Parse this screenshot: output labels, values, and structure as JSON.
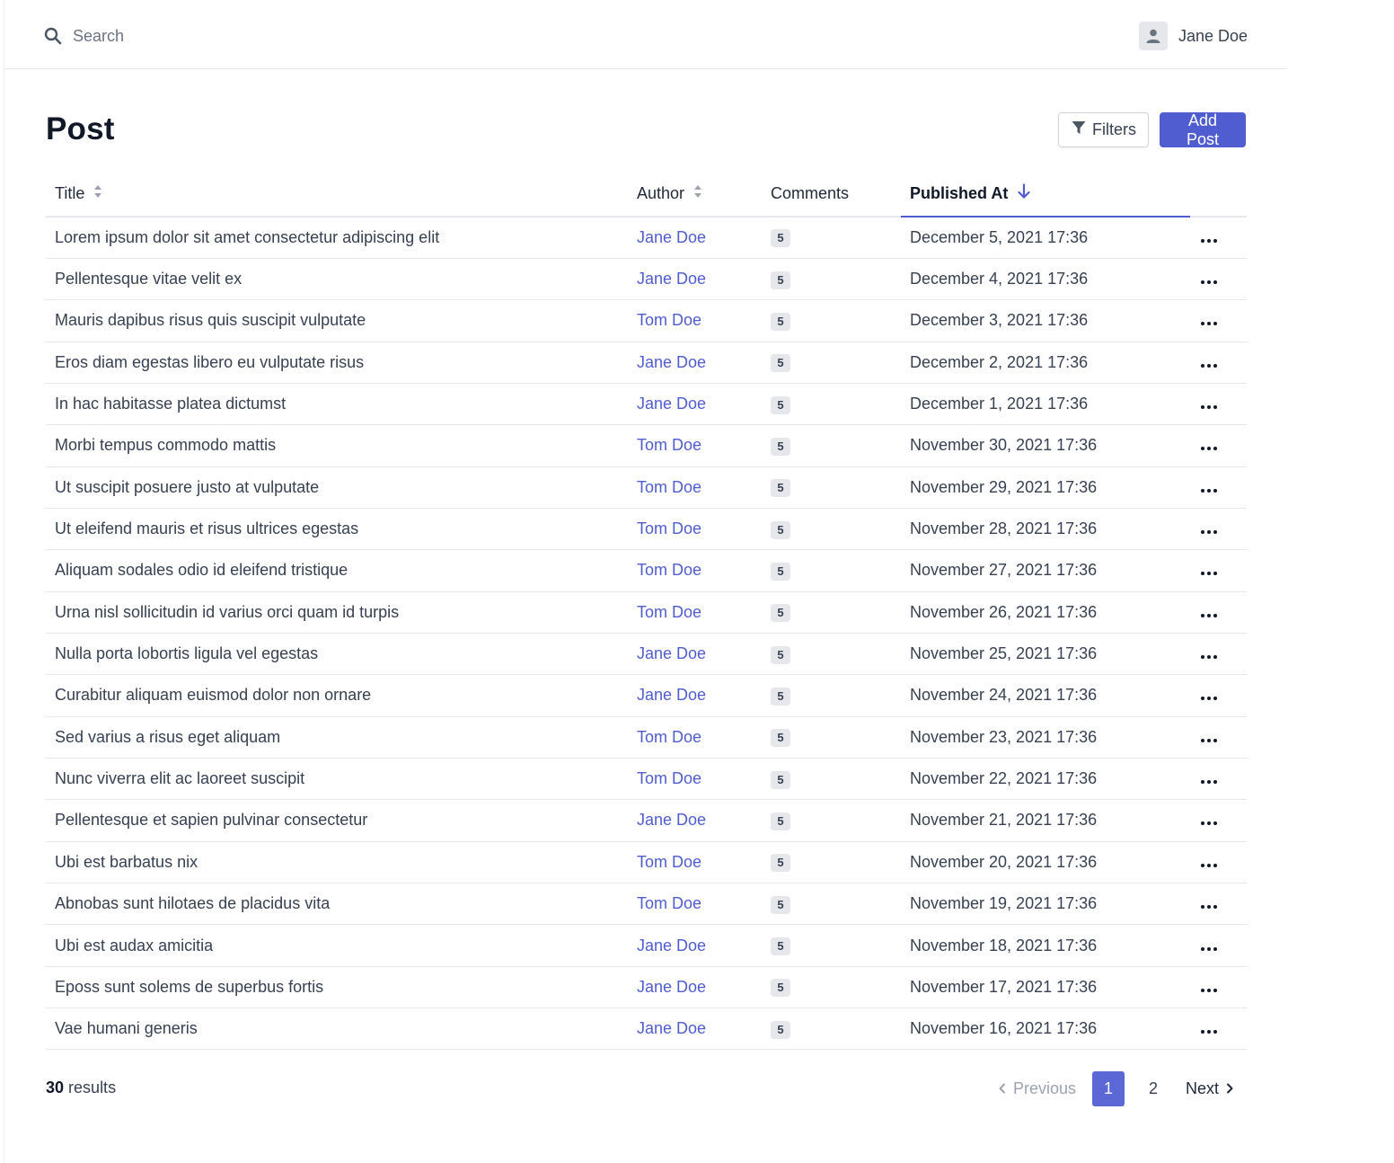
{
  "topbar": {
    "search_placeholder": "Search",
    "user_name": "Jane Doe",
    "search_icon": "search-icon",
    "user_icon": "user-icon"
  },
  "page": {
    "title": "Post",
    "filters_label": "Filters",
    "add_label": "Add Post"
  },
  "colors": {
    "accent": "#4f5dd0",
    "badge_bg": "#e5e7eb"
  },
  "table": {
    "columns": {
      "title": "Title",
      "author": "Author",
      "comments": "Comments",
      "published": "Published At"
    },
    "sort_column": "Published At",
    "sort_direction": "descending",
    "rows": [
      {
        "title": "Lorem ipsum dolor sit amet consectetur adipiscing elit",
        "author": "Jane Doe",
        "comments": "5",
        "published": "December 5, 2021 17:36"
      },
      {
        "title": "Pellentesque vitae velit ex",
        "author": "Jane Doe",
        "comments": "5",
        "published": "December 4, 2021 17:36"
      },
      {
        "title": "Mauris dapibus risus quis suscipit vulputate",
        "author": "Tom Doe",
        "comments": "5",
        "published": "December 3, 2021 17:36"
      },
      {
        "title": "Eros diam egestas libero eu vulputate risus",
        "author": "Jane Doe",
        "comments": "5",
        "published": "December 2, 2021 17:36"
      },
      {
        "title": "In hac habitasse platea dictumst",
        "author": "Jane Doe",
        "comments": "5",
        "published": "December 1, 2021 17:36"
      },
      {
        "title": "Morbi tempus commodo mattis",
        "author": "Tom Doe",
        "comments": "5",
        "published": "November 30, 2021 17:36"
      },
      {
        "title": "Ut suscipit posuere justo at vulputate",
        "author": "Tom Doe",
        "comments": "5",
        "published": "November 29, 2021 17:36"
      },
      {
        "title": "Ut eleifend mauris et risus ultrices egestas",
        "author": "Tom Doe",
        "comments": "5",
        "published": "November 28, 2021 17:36"
      },
      {
        "title": "Aliquam sodales odio id eleifend tristique",
        "author": "Tom Doe",
        "comments": "5",
        "published": "November 27, 2021 17:36"
      },
      {
        "title": "Urna nisl sollicitudin id varius orci quam id turpis",
        "author": "Tom Doe",
        "comments": "5",
        "published": "November 26, 2021 17:36"
      },
      {
        "title": "Nulla porta lobortis ligula vel egestas",
        "author": "Jane Doe",
        "comments": "5",
        "published": "November 25, 2021 17:36"
      },
      {
        "title": "Curabitur aliquam euismod dolor non ornare",
        "author": "Jane Doe",
        "comments": "5",
        "published": "November 24, 2021 17:36"
      },
      {
        "title": "Sed varius a risus eget aliquam",
        "author": "Tom Doe",
        "comments": "5",
        "published": "November 23, 2021 17:36"
      },
      {
        "title": "Nunc viverra elit ac laoreet suscipit",
        "author": "Tom Doe",
        "comments": "5",
        "published": "November 22, 2021 17:36"
      },
      {
        "title": "Pellentesque et sapien pulvinar consectetur",
        "author": "Jane Doe",
        "comments": "5",
        "published": "November 21, 2021 17:36"
      },
      {
        "title": "Ubi est barbatus nix",
        "author": "Tom Doe",
        "comments": "5",
        "published": "November 20, 2021 17:36"
      },
      {
        "title": "Abnobas sunt hilotaes de placidus vita",
        "author": "Tom Doe",
        "comments": "5",
        "published": "November 19, 2021 17:36"
      },
      {
        "title": "Ubi est audax amicitia",
        "author": "Jane Doe",
        "comments": "5",
        "published": "November 18, 2021 17:36"
      },
      {
        "title": "Eposs sunt solems de superbus fortis",
        "author": "Jane Doe",
        "comments": "5",
        "published": "November 17, 2021 17:36"
      },
      {
        "title": "Vae humani generis",
        "author": "Jane Doe",
        "comments": "5",
        "published": "November 16, 2021 17:36"
      }
    ]
  },
  "footer": {
    "results_count": "30",
    "results_label": "results",
    "prev_label": "Previous",
    "next_label": "Next",
    "pages": [
      "1",
      "2"
    ],
    "current_page": "1"
  }
}
